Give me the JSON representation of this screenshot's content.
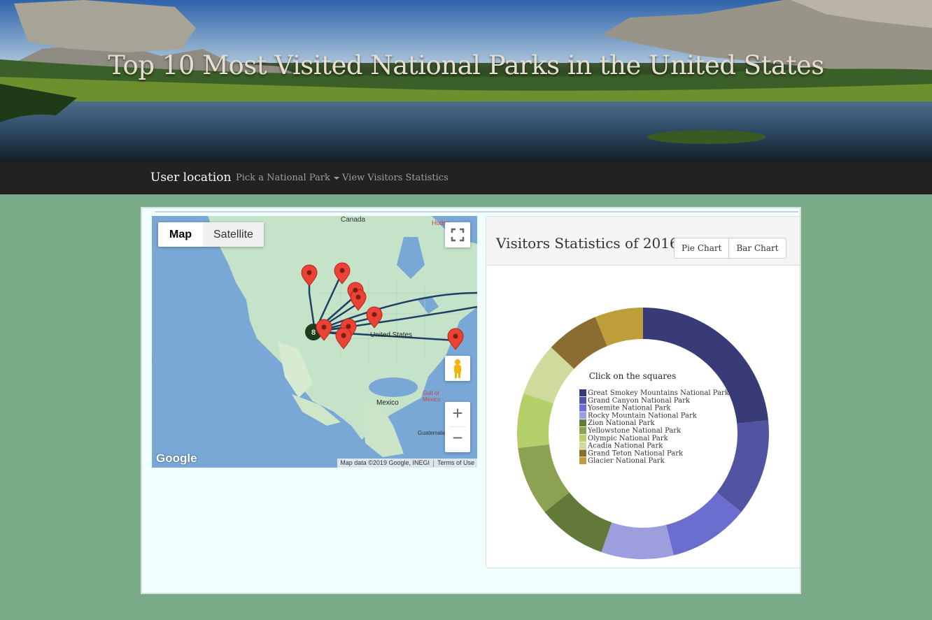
{
  "hero": {
    "title": "Top 10 Most Visited National Parks in the United States"
  },
  "navbar": {
    "brand": "User location",
    "items": [
      {
        "label": "Pick a National Park",
        "dropdown": true
      },
      {
        "label": "View Visitors Statistics",
        "dropdown": false
      }
    ]
  },
  "map": {
    "type_buttons": [
      "Map",
      "Satellite"
    ],
    "active_type": "Map",
    "labels": {
      "canada": "Canada",
      "united_states": "United States",
      "mexico": "Mexico",
      "gulf": "Gulf of\nMexico",
      "guatemala": "Guatemala",
      "hudson": "Hudso"
    },
    "logo": "Google",
    "attribution": "Map data ©2019 Google, INEGI",
    "terms": "Terms of Use",
    "controls": {
      "fullscreen_icon": "fullscreen-icon",
      "pegman_icon": "pegman-icon",
      "zoom_in": "+",
      "zoom_out": "−"
    },
    "marker_color": "#ea4335",
    "route_color": "#1f3f63"
  },
  "stats": {
    "title": "Visitors Statistics of 2016",
    "buttons": [
      "Pie Chart",
      "Bar Chart"
    ]
  },
  "chart_data": {
    "type": "pie",
    "subtitle": "Click on the squares",
    "categories": [
      "Great Smokey Mountains National Park",
      "Grand Canyon National Park",
      "Yosemite National Park",
      "Rocky Mountain National Park",
      "Zion National Park",
      "Yellowstone National Park",
      "Olympic National Park",
      "Acadia National Park",
      "Grand Teton National Park",
      "Glacier National Park"
    ],
    "values": [
      11.3,
      6.0,
      5.0,
      4.5,
      4.3,
      4.3,
      3.4,
      3.3,
      3.3,
      3.0
    ],
    "colors": [
      "#393b79",
      "#5254a3",
      "#6b6ecf",
      "#9c9ede",
      "#637939",
      "#8ca252",
      "#b5cf6b",
      "#cedb9c",
      "#8c6d31",
      "#bd9e39"
    ],
    "donut": true,
    "legend": "center"
  }
}
